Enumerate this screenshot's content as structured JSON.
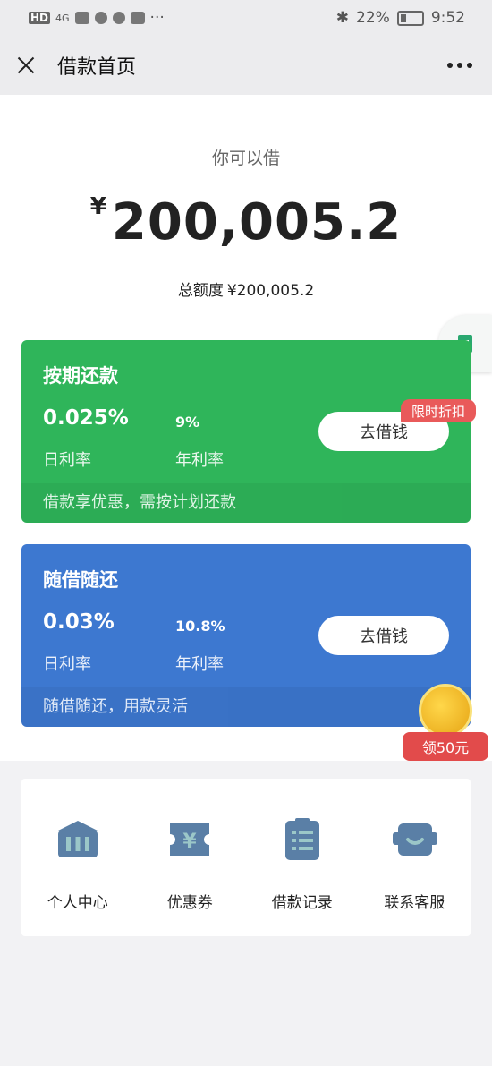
{
  "status_bar": {
    "network": "HD",
    "signal": "4G",
    "battery": "22%",
    "time": "9:52"
  },
  "navbar": {
    "title": "借款首页"
  },
  "summary": {
    "can_borrow_label": "你可以借",
    "currency": "¥",
    "amount": "200,005.2",
    "total_label": "总额度",
    "total_value": "¥200,005.2"
  },
  "products": [
    {
      "title": "按期还款",
      "daily_rate": "0.025%",
      "daily_rate_label": "日利率",
      "annual_rate": "9%",
      "annual_rate_label": "年利率",
      "button": "去借钱",
      "note": "借款享优惠，需按计划还款",
      "badge": "限时折扣"
    },
    {
      "title": "随借随还",
      "daily_rate": "0.03%",
      "daily_rate_label": "日利率",
      "annual_rate": "10.8%",
      "annual_rate_label": "年利率",
      "button": "去借钱",
      "note": "随借随还，用款灵活"
    }
  ],
  "coin_promo": {
    "label": "领50元"
  },
  "grid": [
    {
      "label": "个人中心",
      "icon": "bank-icon"
    },
    {
      "label": "优惠券",
      "icon": "coupon-icon"
    },
    {
      "label": "借款记录",
      "icon": "record-icon"
    },
    {
      "label": "联系客服",
      "icon": "customer-service-icon"
    }
  ],
  "colors": {
    "green_card": "#2fb55a",
    "blue_card": "#3d78d0",
    "badge_red": "#e95a5a",
    "icon_blue": "#5a7fa6"
  }
}
